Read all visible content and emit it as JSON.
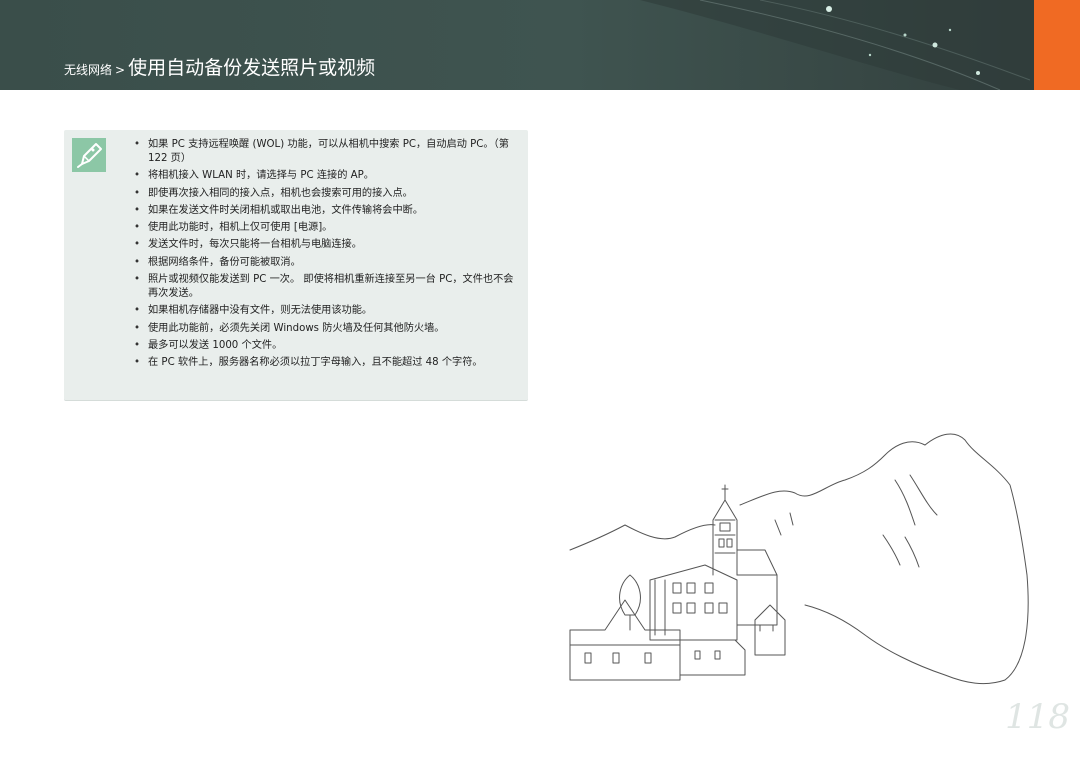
{
  "header": {
    "breadcrumb_parent": "无线网络",
    "separator": ">",
    "title": "使用自动备份发送照片或视频",
    "background_color": "#3f5450",
    "tab_color": "#f06a23"
  },
  "note": {
    "icon": "pen-note-icon",
    "icon_color": "#8cc7a6",
    "items": [
      "如果 PC 支持远程唤醒 (WOL) 功能，可以从相机中搜索 PC，自动启动 PC。（第 122 页）",
      "将相机接入 WLAN 时，请选择与 PC 连接的 AP。",
      "即使再次接入相同的接入点，相机也会搜索可用的接入点。",
      "如果在发送文件时关闭相机或取出电池，文件传输将会中断。",
      "使用此功能时，相机上仅可使用 [电源]。",
      "发送文件时，每次只能将一台相机与电脑连接。",
      "根据网络条件，备份可能被取消。",
      "照片或视频仅能发送到 PC 一次。 即使将相机重新连接至另一台 PC，文件也不会再次发送。",
      "如果相机存储器中没有文件，则无法使用该功能。",
      "使用此功能前，必须先关闭 Windows 防火墙及任何其他防火墙。",
      "最多可以发送 1000 个文件。",
      "在 PC 软件上，服务器名称必须以拉丁字母输入，且不能超过 48 个字符。"
    ]
  },
  "illustration": {
    "icon": "village-sketch-illustration"
  },
  "page_number": "118"
}
